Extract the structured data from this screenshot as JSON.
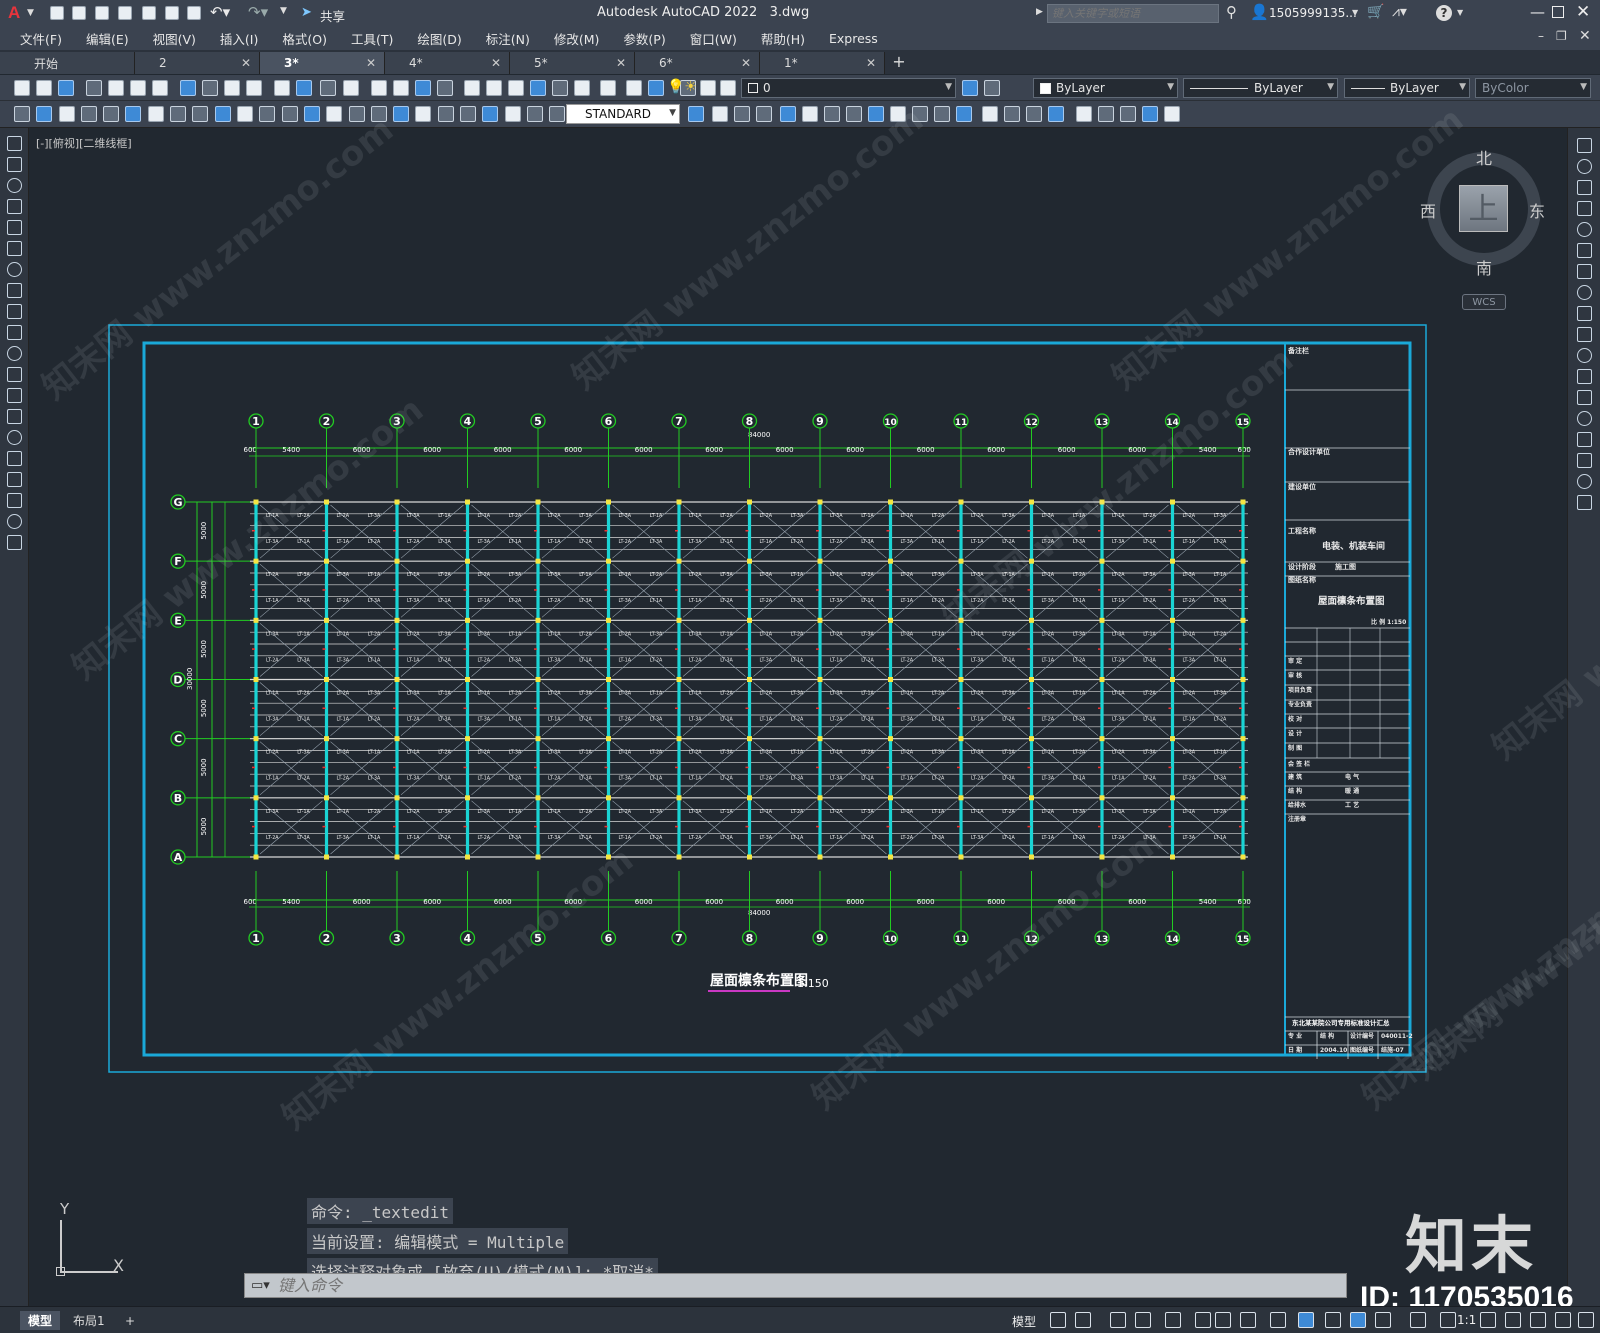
{
  "title": {
    "app": "Autodesk AutoCAD 2022",
    "file": "3.dwg",
    "search_placeholder": "键入关键字或短语",
    "user": "1505999135...",
    "share": "共享",
    "app_letter": "A"
  },
  "menu": [
    "文件(F)",
    "编辑(E)",
    "视图(V)",
    "插入(I)",
    "格式(O)",
    "工具(T)",
    "绘图(D)",
    "标注(N)",
    "修改(M)",
    "参数(P)",
    "窗口(W)",
    "帮助(H)",
    "Express"
  ],
  "file_tabs": [
    {
      "label": "开始",
      "close": false
    },
    {
      "label": "2",
      "close": true
    },
    {
      "label": "3*",
      "close": true,
      "active": true
    },
    {
      "label": "4*",
      "close": true
    },
    {
      "label": "5*",
      "close": true
    },
    {
      "label": "6*",
      "close": true
    },
    {
      "label": "1*",
      "close": true
    }
  ],
  "new_tab": "+",
  "toolbar": {
    "layer": "0",
    "color": "ByLayer",
    "linetype": "ByLayer",
    "lineweight": "ByLayer",
    "plotstyle": "ByColor",
    "textstyle": "STANDARD"
  },
  "viewport_label": "[-][俯视][二维线框]",
  "viewcube": {
    "n": "北",
    "s": "南",
    "e": "东",
    "w": "西",
    "top": "上",
    "wcs": "WCS"
  },
  "drawing": {
    "title": "屋面檩条布置图",
    "scale": "1:150",
    "total_length": "84000",
    "total_width": "30000",
    "top_axes": [
      "1",
      "2",
      "3",
      "4",
      "5",
      "6",
      "7",
      "8",
      "9",
      "10",
      "11",
      "12",
      "13",
      "14",
      "15"
    ],
    "row_axes": [
      "G",
      "F",
      "E",
      "D",
      "C",
      "B",
      "A"
    ],
    "spans": [
      "600",
      "5400",
      "6000",
      "6000",
      "6000",
      "6000",
      "6000",
      "6000",
      "6000",
      "6000",
      "6000",
      "6000",
      "6000",
      "6000",
      "5400",
      "600"
    ],
    "bay_widths": [
      "5000",
      "5000",
      "5000",
      "5000",
      "5000",
      "5000"
    ],
    "title_block": {
      "project_name": "电装、机装车间",
      "drawing_name": "屋面檩条布置图",
      "design_stage": "施工图",
      "institute": "东北某某院公司专用标准设计汇总",
      "drawing_no": "040011-2",
      "sheet": "结施-07",
      "date": "2004.10",
      "scale_label": "比 例 1:150",
      "rows": [
        "审 定",
        "审 核",
        "项目负责",
        "专业负责",
        "校 对",
        "设 计",
        "制 图"
      ],
      "labels": [
        "备注栏",
        "合作设计单位",
        "建设单位",
        "工程名称",
        "设计阶段",
        "图纸名称",
        "会 签 栏",
        "建 筑",
        "结 构",
        "给排水",
        "电 气",
        "暖 通",
        "工 艺",
        "注册章"
      ],
      "footer": [
        "专 业",
        "结 构",
        "设计编号",
        "日 期",
        "图纸编号"
      ]
    }
  },
  "command_history": [
    "命令: _textedit",
    "当前设置: 编辑模式 = Multiple",
    "选择注释对象或 [放弃(U)/模式(M)]: *取消*"
  ],
  "command_placeholder": "键入命令",
  "layout_tabs": [
    "模型",
    "布局1",
    "+"
  ],
  "status": {
    "model": "模型",
    "scale": "1:1"
  },
  "ucs": {
    "x": "X",
    "y": "Y"
  },
  "watermark": {
    "logo": "知末",
    "id": "ID: 1170535016",
    "text": "知末网 www.znzmo.com"
  },
  "colors": {
    "frame": "#1aa9d8",
    "axis": "#22cc22",
    "column": "#1ad4d4",
    "purlin": "#d8d8d8",
    "grid_bg": "#212830"
  }
}
